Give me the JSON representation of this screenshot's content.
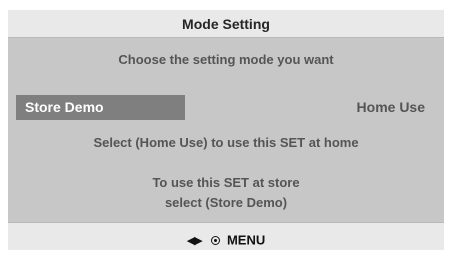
{
  "dialog": {
    "title": "Mode Setting",
    "subtitle": "Choose the setting mode you want",
    "options": [
      {
        "label": "Store Demo",
        "selected": true
      },
      {
        "label": "Home Use",
        "selected": false
      }
    ],
    "hint_home": "Select (Home Use) to use this SET at home",
    "hint_store_line1": "To use this SET at store",
    "hint_store_line2": "select (Store Demo)"
  },
  "footer": {
    "nav_glyph": "◀▶",
    "ok_icon": "ok-circle-icon",
    "menu_label": "MENU"
  },
  "colors": {
    "panel_bg": "#c7c7c7",
    "bar_bg": "#e9e9e9",
    "selected_bg": "#7f7f7f",
    "text": "#555555"
  }
}
